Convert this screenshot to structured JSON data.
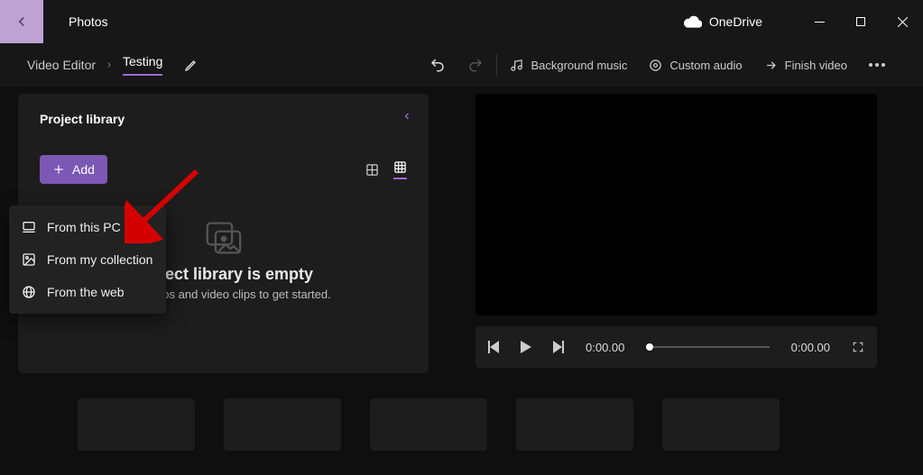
{
  "titlebar": {
    "app": "Photos",
    "onedrive": "OneDrive"
  },
  "toolbar": {
    "breadcrumb": "Video Editor",
    "project_name": "Testing",
    "bg_music": "Background music",
    "custom_audio": "Custom audio",
    "finish": "Finish video"
  },
  "library": {
    "title": "Project library",
    "add": "Add",
    "empty_title": "Project library is empty",
    "empty_sub": "Add photos and video clips to get started."
  },
  "player": {
    "current": "0:00.00",
    "total": "0:00.00"
  },
  "menu": {
    "from_pc": "From this PC",
    "from_collection": "From my collection",
    "from_web": "From the web"
  }
}
